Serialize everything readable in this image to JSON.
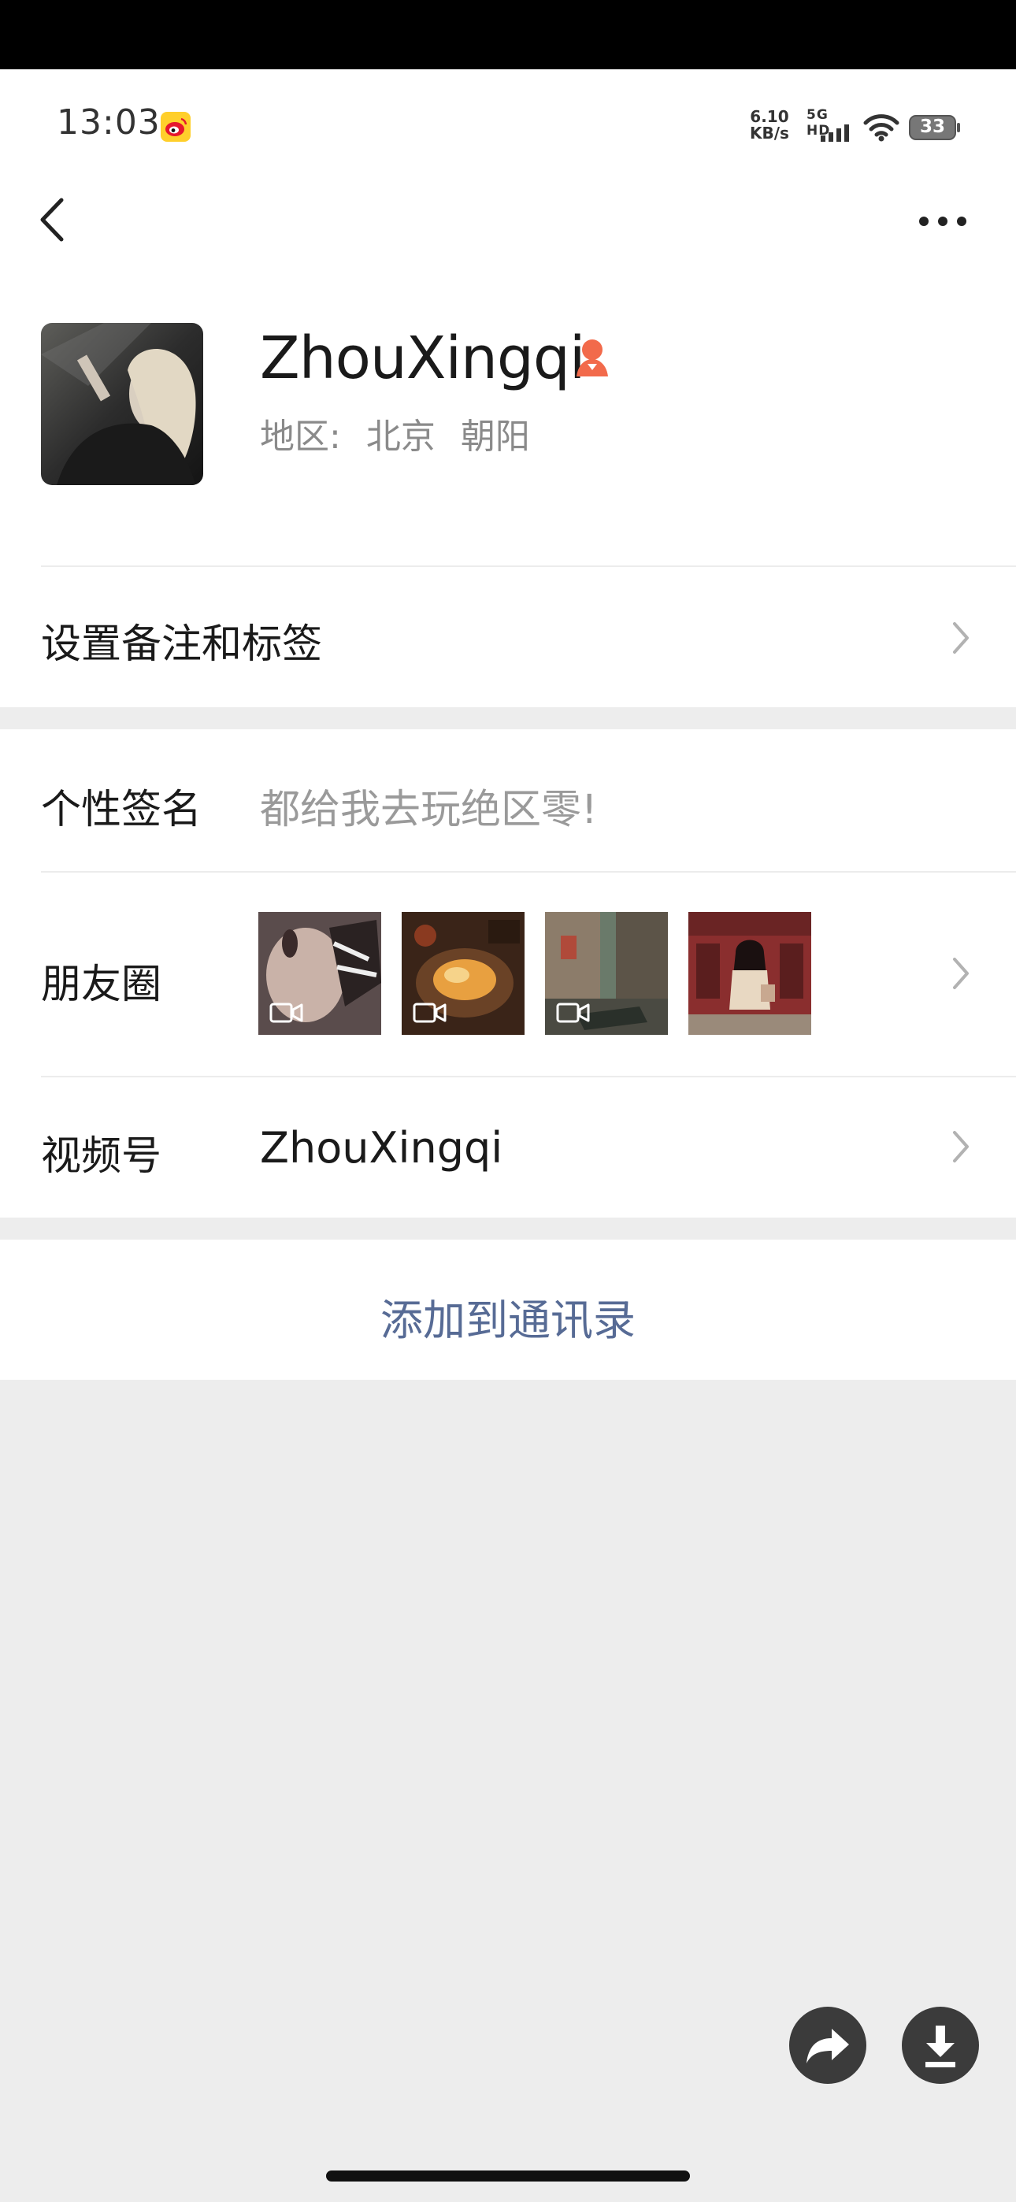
{
  "status_bar": {
    "time": "13:03",
    "net_speed_value": "6.10",
    "net_speed_unit": "KB/s",
    "network": "5G HD",
    "battery": "33",
    "app_icon": "weibo-icon"
  },
  "nav": {
    "back_icon": "chevron-left-icon",
    "more_icon": "ellipsis-icon"
  },
  "profile": {
    "name": "ZhouXingqi",
    "verify_icon": "person-badge-icon",
    "region_label": "地区:",
    "region_city": "北京",
    "region_district": "朝阳"
  },
  "rows": {
    "remark_label": "设置备注和标签",
    "signature_label": "个性签名",
    "signature_text": "都给我去玩绝区零!",
    "moments_label": "朋友圈",
    "channels_label": "视频号",
    "channels_name": "ZhouXingqi"
  },
  "moments": [
    {
      "name": "moment-photo-nails",
      "has_video": true,
      "color": "#6b5a5a"
    },
    {
      "name": "moment-photo-food",
      "has_video": true,
      "color": "#8a5a2a"
    },
    {
      "name": "moment-photo-game",
      "has_video": true,
      "color": "#5a6a58"
    },
    {
      "name": "moment-photo-girl",
      "has_video": false,
      "color": "#8a3a3a"
    }
  ],
  "actions": {
    "add_contact": "添加到通讯录",
    "share_icon": "share-arrow-icon",
    "download_icon": "download-icon"
  },
  "colors": {
    "link_blue": "#576b95",
    "background": "#ededed",
    "verify_orange": "#f26a4b"
  }
}
